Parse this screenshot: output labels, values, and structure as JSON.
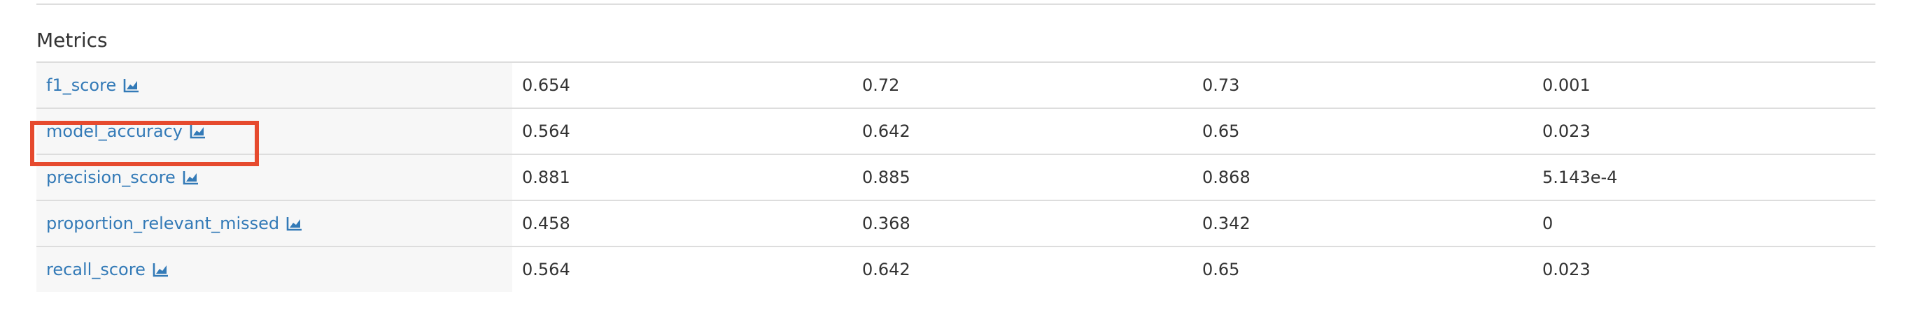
{
  "section": {
    "title": "Metrics"
  },
  "metrics": [
    {
      "name": "f1_score",
      "values": [
        "0.654",
        "0.72",
        "0.73",
        "0.001"
      ],
      "icon": "chart-line-icon"
    },
    {
      "name": "model_accuracy",
      "values": [
        "0.564",
        "0.642",
        "0.65",
        "0.023"
      ],
      "icon": "chart-line-icon"
    },
    {
      "name": "precision_score",
      "values": [
        "0.881",
        "0.885",
        "0.868",
        "5.143e-4"
      ],
      "icon": "chart-line-icon"
    },
    {
      "name": "proportion_relevant_missed",
      "values": [
        "0.458",
        "0.368",
        "0.342",
        "0"
      ],
      "icon": "chart-line-icon"
    },
    {
      "name": "recall_score",
      "values": [
        "0.564",
        "0.642",
        "0.65",
        "0.023"
      ],
      "icon": "chart-line-icon"
    }
  ],
  "highlight": {
    "target": "model_accuracy",
    "color": "#e64a2e"
  },
  "colors": {
    "link": "#337ab7",
    "text": "#333333",
    "row_border": "#dddddd",
    "name_cell_bg": "#f7f7f7"
  }
}
